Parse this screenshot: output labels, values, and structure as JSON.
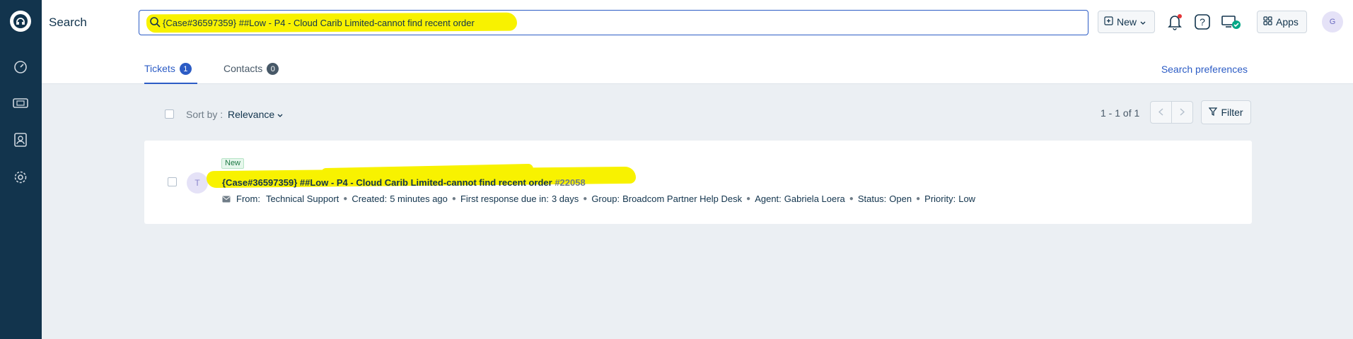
{
  "header": {
    "title": "Search",
    "search_value": "{Case#36597359} ##Low - P4 - Cloud Carib Limited-cannot find recent order",
    "new_label": "New",
    "apps_label": "Apps",
    "avatar_initial": "G"
  },
  "tabs": [
    {
      "label": "Tickets",
      "count": "1"
    },
    {
      "label": "Contacts",
      "count": "0"
    }
  ],
  "search_preferences_label": "Search preferences",
  "toolbar": {
    "sort_by_label": "Sort by :",
    "sort_value": "Relevance",
    "pager_text": "1 - 1 of 1",
    "filter_label": "Filter"
  },
  "tickets": [
    {
      "avatar_initial": "T",
      "status_badge": "New",
      "subject": "{Case#36597359} ##Low - P4 - Cloud Carib Limited-cannot find recent order",
      "number": "#22058",
      "from_label": "From:",
      "from_value": "Technical Support",
      "created_label": "Created:",
      "created_value": "5 minutes ago",
      "first_response_label": "First response due in:",
      "first_response_value": "3 days",
      "group_label": "Group:",
      "group_value": "Broadcom Partner Help Desk",
      "agent_label": "Agent:",
      "agent_value": "Gabriela Loera",
      "status_label": "Status:",
      "status_value": "Open",
      "priority_label": "Priority:",
      "priority_value": "Low"
    }
  ],
  "colors": {
    "rail": "#12344d",
    "accent": "#2c5cc5",
    "highlight": "#f8f200",
    "success": "#00a886"
  }
}
